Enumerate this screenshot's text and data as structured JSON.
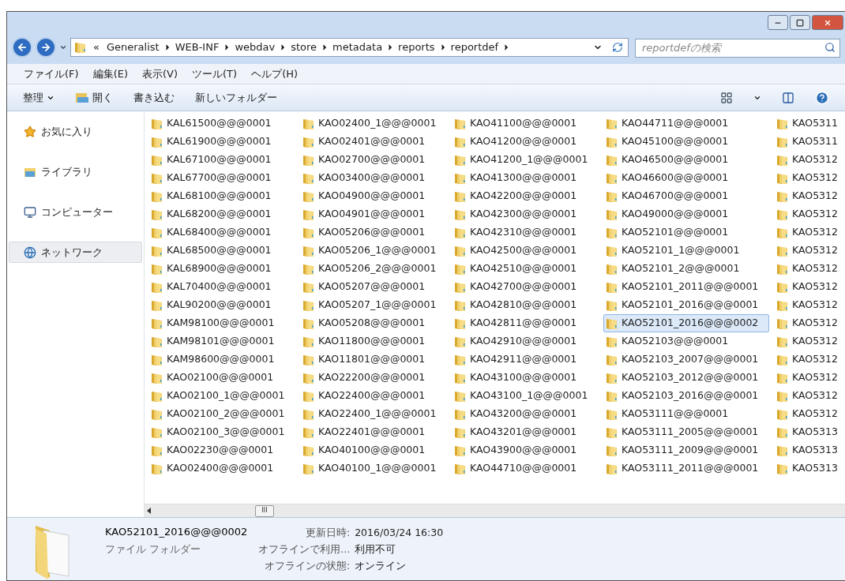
{
  "address_bar": {
    "overflow": "«",
    "crumbs": [
      "Generalist",
      "WEB-INF",
      "webdav",
      "store",
      "metadata",
      "reports",
      "reportdef"
    ]
  },
  "search": {
    "placeholder": "reportdefの検索"
  },
  "menu": [
    "ファイル(F)",
    "編集(E)",
    "表示(V)",
    "ツール(T)",
    "ヘルプ(H)"
  ],
  "toolbar": [
    {
      "label": "整理",
      "kind": "dropdown"
    },
    {
      "label": "開く",
      "kind": "open"
    },
    {
      "label": "書き込む",
      "kind": "plain"
    },
    {
      "label": "新しいフォルダー",
      "kind": "plain"
    }
  ],
  "sidebar": {
    "items": [
      {
        "label": "お気に入り",
        "kind": "favorites",
        "selected": false
      },
      {
        "label": "ライブラリ",
        "kind": "library",
        "selected": false
      },
      {
        "label": "コンピューター",
        "kind": "computer",
        "selected": false
      },
      {
        "label": "ネットワーク",
        "kind": "network",
        "selected": true
      }
    ]
  },
  "files": [
    {
      "name": "KAL61500@@@0001",
      "selected": false
    },
    {
      "name": "KAL61900@@@0001",
      "selected": false
    },
    {
      "name": "KAL67100@@@0001",
      "selected": false
    },
    {
      "name": "KAL67700@@@0001",
      "selected": false
    },
    {
      "name": "KAL68100@@@0001",
      "selected": false
    },
    {
      "name": "KAL68200@@@0001",
      "selected": false
    },
    {
      "name": "KAL68400@@@0001",
      "selected": false
    },
    {
      "name": "KAL68500@@@0001",
      "selected": false
    },
    {
      "name": "KAL68900@@@0001",
      "selected": false
    },
    {
      "name": "KAL70400@@@0001",
      "selected": false
    },
    {
      "name": "KAL90200@@@0001",
      "selected": false
    },
    {
      "name": "KAM98100@@@0001",
      "selected": false
    },
    {
      "name": "KAM98101@@@0001",
      "selected": false
    },
    {
      "name": "KAM98600@@@0001",
      "selected": false
    },
    {
      "name": "KAO02100@@@0001",
      "selected": false
    },
    {
      "name": "KAO02100_1@@@0001",
      "selected": false
    },
    {
      "name": "KAO02100_2@@@0001",
      "selected": false
    },
    {
      "name": "KAO02100_3@@@0001",
      "selected": false
    },
    {
      "name": "KAO02230@@@0001",
      "selected": false
    },
    {
      "name": "KAO02400@@@0001",
      "selected": false
    },
    {
      "name": "KAO02400_1@@@0001",
      "selected": false
    },
    {
      "name": "KAO02401@@@0001",
      "selected": false
    },
    {
      "name": "KAO02700@@@0001",
      "selected": false
    },
    {
      "name": "KAO03400@@@0001",
      "selected": false
    },
    {
      "name": "KAO04900@@@0001",
      "selected": false
    },
    {
      "name": "KAO04901@@@0001",
      "selected": false
    },
    {
      "name": "KAO05206@@@0001",
      "selected": false
    },
    {
      "name": "KAO05206_1@@@0001",
      "selected": false
    },
    {
      "name": "KAO05206_2@@@0001",
      "selected": false
    },
    {
      "name": "KAO05207@@@0001",
      "selected": false
    },
    {
      "name": "KAO05207_1@@@0001",
      "selected": false
    },
    {
      "name": "KAO05208@@@0001",
      "selected": false
    },
    {
      "name": "KAO11800@@@0001",
      "selected": false
    },
    {
      "name": "KAO11801@@@0001",
      "selected": false
    },
    {
      "name": "KAO22200@@@0001",
      "selected": false
    },
    {
      "name": "KAO22400@@@0001",
      "selected": false
    },
    {
      "name": "KAO22400_1@@@0001",
      "selected": false
    },
    {
      "name": "KAO22401@@@0001",
      "selected": false
    },
    {
      "name": "KAO40100@@@0001",
      "selected": false
    },
    {
      "name": "KAO40100_1@@@0001",
      "selected": false
    },
    {
      "name": "KAO41100@@@0001",
      "selected": false
    },
    {
      "name": "KAO41200@@@0001",
      "selected": false
    },
    {
      "name": "KAO41200_1@@@0001",
      "selected": false
    },
    {
      "name": "KAO41300@@@0001",
      "selected": false
    },
    {
      "name": "KAO42200@@@0001",
      "selected": false
    },
    {
      "name": "KAO42300@@@0001",
      "selected": false
    },
    {
      "name": "KAO42310@@@0001",
      "selected": false
    },
    {
      "name": "KAO42500@@@0001",
      "selected": false
    },
    {
      "name": "KAO42510@@@0001",
      "selected": false
    },
    {
      "name": "KAO42700@@@0001",
      "selected": false
    },
    {
      "name": "KAO42810@@@0001",
      "selected": false
    },
    {
      "name": "KAO42811@@@0001",
      "selected": false
    },
    {
      "name": "KAO42910@@@0001",
      "selected": false
    },
    {
      "name": "KAO42911@@@0001",
      "selected": false
    },
    {
      "name": "KAO43100@@@0001",
      "selected": false
    },
    {
      "name": "KAO43100_1@@@0001",
      "selected": false
    },
    {
      "name": "KAO43200@@@0001",
      "selected": false
    },
    {
      "name": "KAO43201@@@0001",
      "selected": false
    },
    {
      "name": "KAO43900@@@0001",
      "selected": false
    },
    {
      "name": "KAO44710@@@0001",
      "selected": false
    },
    {
      "name": "KAO44711@@@0001",
      "selected": false
    },
    {
      "name": "KAO45100@@@0001",
      "selected": false
    },
    {
      "name": "KAO46500@@@0001",
      "selected": false
    },
    {
      "name": "KAO46600@@@0001",
      "selected": false
    },
    {
      "name": "KAO46700@@@0001",
      "selected": false
    },
    {
      "name": "KAO49000@@@0001",
      "selected": false
    },
    {
      "name": "KAO52101@@@0001",
      "selected": false
    },
    {
      "name": "KAO52101_1@@@0001",
      "selected": false
    },
    {
      "name": "KAO52101_2@@@0001",
      "selected": false
    },
    {
      "name": "KAO52101_2011@@@0001",
      "selected": false
    },
    {
      "name": "KAO52101_2016@@@0001",
      "selected": false
    },
    {
      "name": "KAO52101_2016@@@0002",
      "selected": true
    },
    {
      "name": "KAO52103@@@0001",
      "selected": false
    },
    {
      "name": "KAO52103_2007@@@0001",
      "selected": false
    },
    {
      "name": "KAO52103_2012@@@0001",
      "selected": false
    },
    {
      "name": "KAO52103_2016@@@0001",
      "selected": false
    },
    {
      "name": "KAO53111@@@0001",
      "selected": false
    },
    {
      "name": "KAO53111_2005@@@0001",
      "selected": false
    },
    {
      "name": "KAO53111_2009@@@0001",
      "selected": false
    },
    {
      "name": "KAO53111_2011@@@0001",
      "selected": false
    },
    {
      "name": "KAO5311",
      "selected": false
    },
    {
      "name": "KAO5311",
      "selected": false
    },
    {
      "name": "KAO5312",
      "selected": false
    },
    {
      "name": "KAO5312",
      "selected": false
    },
    {
      "name": "KAO5312",
      "selected": false
    },
    {
      "name": "KAO5312",
      "selected": false
    },
    {
      "name": "KAO5312",
      "selected": false
    },
    {
      "name": "KAO5312",
      "selected": false
    },
    {
      "name": "KAO5312",
      "selected": false
    },
    {
      "name": "KAO5312",
      "selected": false
    },
    {
      "name": "KAO5312",
      "selected": false
    },
    {
      "name": "KAO5312",
      "selected": false
    },
    {
      "name": "KAO5312",
      "selected": false
    },
    {
      "name": "KAO5312",
      "selected": false
    },
    {
      "name": "KAO5312",
      "selected": false
    },
    {
      "name": "KAO5312",
      "selected": false
    },
    {
      "name": "KAO5312",
      "selected": false
    },
    {
      "name": "KAO5313",
      "selected": false
    },
    {
      "name": "KAO5313",
      "selected": false
    },
    {
      "name": "KAO5313",
      "selected": false
    }
  ],
  "scrollbar_thumb": "III",
  "details": {
    "name": "KAO52101_2016@@@0002",
    "type": "ファイル フォルダー",
    "properties": [
      {
        "label": "更新日時:",
        "value": "2016/03/24 16:30"
      },
      {
        "label": "オフラインで利用...",
        "value": "利用不可"
      },
      {
        "label": "オフラインの状態:",
        "value": "オンライン"
      }
    ]
  }
}
